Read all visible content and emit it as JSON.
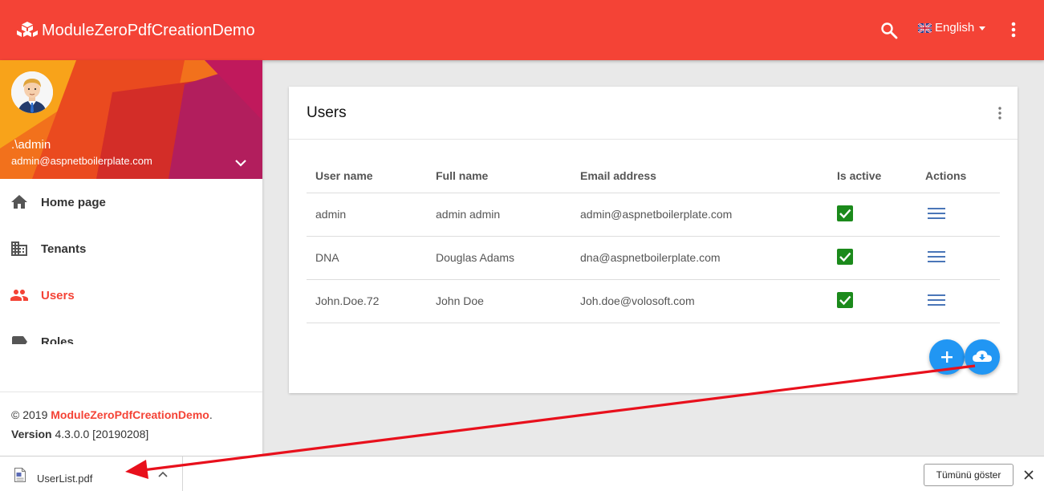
{
  "app": {
    "title": "ModuleZeroPdfCreationDemo"
  },
  "header": {
    "language": "English",
    "icons": {
      "brand": "cubes-icon",
      "search": "search-icon",
      "more": "more-vert-icon",
      "flag": "uk-flag-icon"
    }
  },
  "user": {
    "name": ".\\admin",
    "email": "admin@aspnetboilerplate.com"
  },
  "sidebar": {
    "items": [
      {
        "label": "Home page",
        "icon": "home-icon",
        "active": false
      },
      {
        "label": "Tenants",
        "icon": "business-icon",
        "active": false
      },
      {
        "label": "Users",
        "icon": "people-icon",
        "active": true
      },
      {
        "label": "Roles",
        "icon": "label-icon",
        "active": false
      }
    ],
    "footer": {
      "copyright": "© 2019 ",
      "brand": "ModuleZeroPdfCreationDemo",
      "period": ".",
      "version_label": "Version",
      "version_value": " 4.3.0.0 [20190208]"
    }
  },
  "card": {
    "title": "Users",
    "columns": [
      "User name",
      "Full name",
      "Email address",
      "Is active",
      "Actions"
    ],
    "rows": [
      {
        "username": "admin",
        "fullname": "admin admin",
        "email": "admin@aspnetboilerplate.com",
        "active": true
      },
      {
        "username": "DNA",
        "fullname": "Douglas Adams",
        "email": "dna@aspnetboilerplate.com",
        "active": true
      },
      {
        "username": "John.Doe.72",
        "fullname": "John Doe",
        "email": "Joh.doe@volosoft.com",
        "active": true
      }
    ]
  },
  "downloads": {
    "file": "UserList.pdf",
    "show_all": "Tümünü göster"
  },
  "colors": {
    "primary": "#f44336",
    "accent": "#2196f3",
    "active_check": "#1b8a1b",
    "annotation_arrow": "#e8101c"
  }
}
